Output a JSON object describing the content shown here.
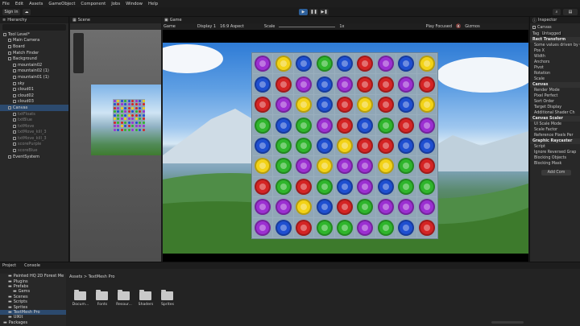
{
  "menu": [
    "File",
    "Edit",
    "Assets",
    "GameObject",
    "Component",
    "Jobs",
    "Window",
    "Help"
  ],
  "toolbar": {
    "account": "Sign in",
    "play": "▶",
    "pause": "❚❚",
    "step": "▶❚"
  },
  "hierarchy": {
    "tab": "Hierarchy",
    "search_placeholder": "",
    "items": [
      {
        "label": "Tool Level*",
        "state": "normal"
      },
      {
        "label": "Main Camera",
        "state": "normal"
      },
      {
        "label": "Board",
        "state": "normal"
      },
      {
        "label": "Match Finder",
        "state": "normal"
      },
      {
        "label": "Background",
        "state": "normal"
      },
      {
        "label": "mountain02",
        "state": "normal"
      },
      {
        "label": "mountain02 (1)",
        "state": "normal"
      },
      {
        "label": "mountain01 (1)",
        "state": "normal"
      },
      {
        "label": "sky",
        "state": "normal"
      },
      {
        "label": "cloud01",
        "state": "normal"
      },
      {
        "label": "cloud02",
        "state": "normal"
      },
      {
        "label": "cloud03",
        "state": "normal"
      },
      {
        "label": "Canvas",
        "state": "selected"
      },
      {
        "label": "txtFloats",
        "state": "dim"
      },
      {
        "label": "txtBlue",
        "state": "dim"
      },
      {
        "label": "txtMove",
        "state": "dim"
      },
      {
        "label": "txtMove_kill_3",
        "state": "dim"
      },
      {
        "label": "txtMove_kill_3",
        "state": "dim"
      },
      {
        "label": "scorePurple",
        "state": "dim"
      },
      {
        "label": "scoreBlue",
        "state": "dim"
      },
      {
        "label": "EventSystem",
        "state": "normal"
      }
    ]
  },
  "scene": {
    "tab": "Scene"
  },
  "game": {
    "tab": "Game",
    "display_mode": "Game",
    "display": "Display 1",
    "aspect": "16:9 Aspect",
    "scale_label": "Scale",
    "scale_value": "1x",
    "play_focus": "Play Focused",
    "gizmos": "Gizmos"
  },
  "board": {
    "rows": [
      [
        "purple",
        "yellow",
        "blue",
        "green",
        "blue",
        "red",
        "purple",
        "blue",
        "yellow"
      ],
      [
        "blue",
        "red",
        "purple",
        "blue",
        "purple",
        "red",
        "red",
        "purple",
        "red"
      ],
      [
        "red",
        "purple",
        "yellow",
        "blue",
        "red",
        "yellow",
        "red",
        "blue",
        "yellow"
      ],
      [
        "green",
        "blue",
        "green",
        "purple",
        "red",
        "blue",
        "green",
        "red",
        "purple"
      ],
      [
        "blue",
        "green",
        "green",
        "blue",
        "yellow",
        "red",
        "red",
        "blue",
        "blue"
      ],
      [
        "yellow",
        "green",
        "purple",
        "yellow",
        "purple",
        "purple",
        "yellow",
        "green",
        "red"
      ],
      [
        "red",
        "green",
        "red",
        "green",
        "blue",
        "purple",
        "blue",
        "green",
        "green"
      ],
      [
        "purple",
        "purple",
        "yellow",
        "blue",
        "red",
        "green",
        "purple",
        "purple",
        "purple"
      ],
      [
        "purple",
        "blue",
        "red",
        "green",
        "green",
        "purple",
        "green",
        "blue",
        "red"
      ]
    ],
    "colors": {
      "purple": "#9b2fd1",
      "yellow": "#f2d216",
      "blue": "#1f4fd0",
      "green": "#2fb52c",
      "red": "#d42424"
    }
  },
  "inspector": {
    "tab": "Inspector",
    "object_name": "Canvas",
    "tag_label": "Tag",
    "tag_value": "Untagged",
    "sections": [
      {
        "title": "Rect Transform",
        "rows": [
          "Some values driven by Canv",
          "Pos X",
          "Width",
          "Anchors",
          "Pivot",
          "Rotation",
          "Scale"
        ]
      },
      {
        "title": "Canvas",
        "rows": [
          "Render Mode",
          "Pixel Perfect",
          "Sort Order",
          "Target Display",
          "Additional Shader Ch"
        ]
      },
      {
        "title": "Canvas Scaler",
        "rows": [
          "UI Scale Mode",
          "Scale Factor",
          "Reference Pixels Per"
        ]
      },
      {
        "title": "Graphic Raycaster",
        "rows": [
          "Script",
          "Ignore Reversed Grap",
          "Blocking Objects",
          "Blocking Mask"
        ]
      }
    ],
    "add_component": "Add Com"
  },
  "project": {
    "tab_project": "Project",
    "tab_console": "Console",
    "breadcrumb_root": "Assets",
    "breadcrumb_current": "TextMesh Pro",
    "tree": [
      {
        "label": "Painted HQ 2D Forest Me",
        "indent": 1
      },
      {
        "label": "Plugins",
        "indent": 1
      },
      {
        "label": "Prefabs",
        "indent": 1
      },
      {
        "label": "Gems",
        "indent": 2
      },
      {
        "label": "Scenes",
        "indent": 1
      },
      {
        "label": "Scripts",
        "indent": 1
      },
      {
        "label": "Sprites",
        "indent": 1
      },
      {
        "label": "TextMesh Pro",
        "indent": 1,
        "selected": true
      },
      {
        "label": "UIKit",
        "indent": 1
      },
      {
        "label": "Packages",
        "indent": 0
      }
    ],
    "folders": [
      "Docum...",
      "Fonts",
      "Resour...",
      "Shaders",
      "Sprites"
    ]
  }
}
